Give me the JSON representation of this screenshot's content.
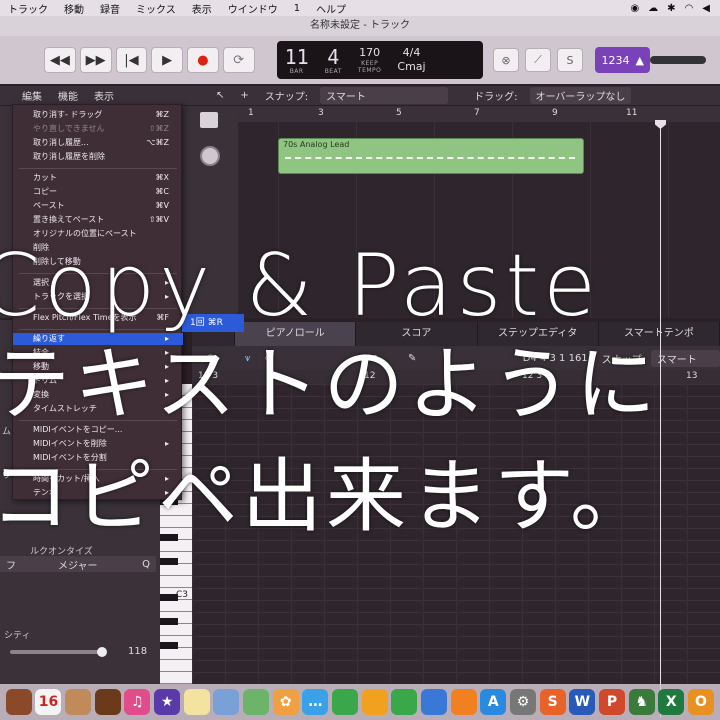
{
  "menubar": {
    "items": [
      "トラック",
      "移動",
      "録音",
      "ミックス",
      "表示",
      "ウインドウ",
      "1",
      "ヘルプ"
    ]
  },
  "window": {
    "title": "名称未設定 - トラック"
  },
  "control_bar": {
    "bar": "11",
    "beat": "4",
    "bar_caption": "BAR",
    "beat_caption": "BEAT",
    "tempo": "170",
    "tempo_keep": "KEEP",
    "tempo_caption": "TEMPO",
    "time_sig": "4/4",
    "key": "Cmaj",
    "count_in": "1234"
  },
  "tracks_toolbar": {
    "edit": "編集",
    "function": "機能",
    "view": "表示",
    "snap_label": "スナップ:",
    "snap_value": "スマート",
    "drag_label": "ドラッグ:",
    "drag_value": "オーバーラップなし"
  },
  "ruler": {
    "marks": [
      "1",
      "3",
      "5",
      "7",
      "9",
      "11"
    ]
  },
  "region": {
    "name": "70s Analog Lead"
  },
  "context_menu": {
    "items": [
      {
        "label": "取り消す- ドラッグ",
        "shortcut": "⌘Z"
      },
      {
        "label": "やり直しできません",
        "shortcut": "⇧⌘Z",
        "dim": true
      },
      {
        "label": "取り消し履歴...",
        "shortcut": "⌥⌘Z"
      },
      {
        "label": "取り消し履歴を削除",
        "shortcut": ""
      },
      {
        "label": "カット",
        "shortcut": "⌘X"
      },
      {
        "label": "コピー",
        "shortcut": "⌘C"
      },
      {
        "label": "ペースト",
        "shortcut": "⌘V"
      },
      {
        "label": "置き換えてペースト",
        "shortcut": "⇧⌘V"
      },
      {
        "label": "オリジナルの位置にペースト",
        "shortcut": ""
      },
      {
        "label": "削除",
        "shortcut": ""
      },
      {
        "label": "削除して移動",
        "shortcut": ""
      },
      {
        "label": "選択",
        "shortcut": "▸"
      },
      {
        "label": "トラックを選択",
        "shortcut": "▸"
      },
      {
        "label": "Flex Pitch/Flex Timeを表示",
        "shortcut": "⌘F"
      },
      {
        "label": "繰り返す",
        "shortcut": "▸",
        "highlight": true
      },
      {
        "label": "結合",
        "shortcut": "▸"
      },
      {
        "label": "移動",
        "shortcut": "▸"
      },
      {
        "label": "トリム",
        "shortcut": "▸"
      },
      {
        "label": "変換",
        "shortcut": "▸"
      },
      {
        "label": "タイムストレッチ",
        "shortcut": "▸"
      },
      {
        "label": "MIDIイベントをコピー...",
        "shortcut": ""
      },
      {
        "label": "MIDIイベントを削除",
        "shortcut": "▸"
      },
      {
        "label": "MIDIイベントを分割",
        "shortcut": ""
      },
      {
        "label": "時間をカット/挿入",
        "shortcut": "▸"
      },
      {
        "label": "テンポ",
        "shortcut": "▸"
      }
    ]
  },
  "submenu": {
    "label": "1回 ⌘R"
  },
  "editor": {
    "tabs": [
      "ピアノロール",
      "スコア",
      "ステップエディタ",
      "スマートテンポ"
    ],
    "active_tab": 0,
    "position": "D4   4 3 1 161",
    "snap_label": "スナップ:",
    "snap_value": "スマート",
    "ruler_marks": [
      "11 3",
      "12",
      "12 3",
      "13"
    ],
    "key_label": "C3"
  },
  "inspector": {
    "scale_label": "ルクオンタイズ",
    "scale_left": "フ",
    "scale_value": "メジャー",
    "q_button": "Q",
    "velocity_label": "シティ",
    "velocity_value": "118",
    "velocity_fraction": 0.93,
    "side_labels": [
      "ム",
      "ウ"
    ]
  },
  "caption": {
    "line1": "Copy & Paste",
    "line2": "テキストのように",
    "line3": "コピペ出来ます。"
  },
  "dock": {
    "icons": [
      {
        "name": "notebook-icon",
        "glyph": "",
        "color": "#8a4a2a"
      },
      {
        "name": "calendar-icon",
        "glyph": "16",
        "color": "#f4f4f4"
      },
      {
        "name": "contacts-icon",
        "glyph": "",
        "color": "#c08a5a"
      },
      {
        "name": "guitar-icon",
        "glyph": "",
        "color": "#6a3a1a"
      },
      {
        "name": "itunes-icon",
        "glyph": "♫",
        "color": "#e14d8a"
      },
      {
        "name": "imovie-icon",
        "glyph": "★",
        "color": "#5a3aa8"
      },
      {
        "name": "notes-icon",
        "glyph": "",
        "color": "#f2e3a0"
      },
      {
        "name": "preview-icon",
        "glyph": "",
        "color": "#7aa0d8"
      },
      {
        "name": "maps-icon",
        "glyph": "",
        "color": "#6cb46a"
      },
      {
        "name": "photos-icon",
        "glyph": "✿",
        "color": "#f0a040"
      },
      {
        "name": "messages-icon",
        "glyph": "…",
        "color": "#3aa0e8"
      },
      {
        "name": "facetime-icon",
        "glyph": "",
        "color": "#3aa84a"
      },
      {
        "name": "pages-icon",
        "glyph": "",
        "color": "#f2a020"
      },
      {
        "name": "numbers-icon",
        "glyph": "",
        "color": "#38a848"
      },
      {
        "name": "keynote-icon",
        "glyph": "",
        "color": "#3a78d8"
      },
      {
        "name": "ibooks-icon",
        "glyph": "",
        "color": "#f08020"
      },
      {
        "name": "appstore-icon",
        "glyph": "A",
        "color": "#2a8ae0"
      },
      {
        "name": "system-preferences-icon",
        "glyph": "⚙",
        "color": "#777"
      },
      {
        "name": "sublime-icon",
        "glyph": "S",
        "color": "#e8622a"
      },
      {
        "name": "word-icon",
        "glyph": "W",
        "color": "#2a5ab8"
      },
      {
        "name": "powerpoint-icon",
        "glyph": "P",
        "color": "#d2482a"
      },
      {
        "name": "chess-icon",
        "glyph": "♞",
        "color": "#3a7a3a"
      },
      {
        "name": "excel-icon",
        "glyph": "X",
        "color": "#207a40"
      },
      {
        "name": "outlook-icon",
        "glyph": "O",
        "color": "#e89020"
      }
    ]
  }
}
